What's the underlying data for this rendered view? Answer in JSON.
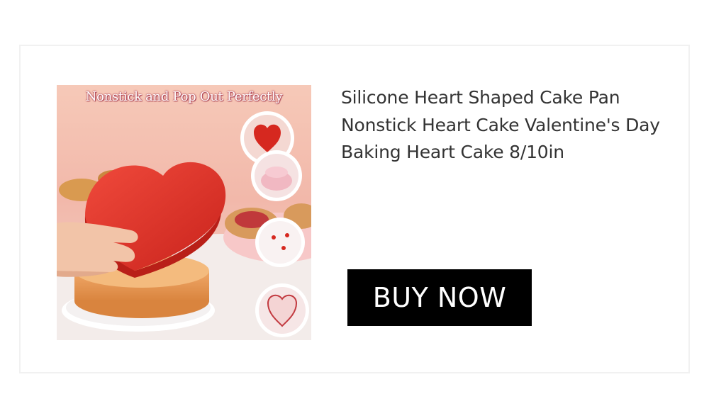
{
  "product": {
    "image_banner_text": "Nonstick and Pop Out Perfectly",
    "title": "Silicone Heart Shaped Cake Pan Nonstick Heart Cake Valentine's Day Baking Heart Cake 8/10in",
    "buy_label": "BUY NOW"
  },
  "colors": {
    "button_background": "#000000",
    "button_text": "#ffffff",
    "title_text": "#333333",
    "card_border": "#f1f1f1",
    "heart_pan": "#e53935"
  }
}
